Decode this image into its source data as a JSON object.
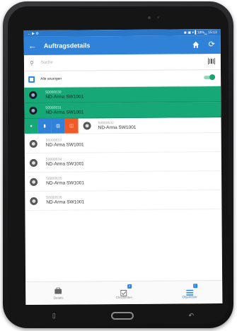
{
  "colors": {
    "primary": "#2f82d8",
    "selected": "#17a877",
    "delete": "#f05a28",
    "badge": "#2f82d8"
  },
  "statusbar": {
    "left": "← ▶ ⚙",
    "right": "◉ ▣ ▾ ▌18%▁ 15:13"
  },
  "appbar": {
    "title": "Auftragsdetails",
    "icons": [
      "back-arrow-icon",
      "home-icon",
      "refresh-icon"
    ]
  },
  "search": {
    "placeholder": "Suche",
    "value": ""
  },
  "show_all": {
    "label": "Alle anzeigen",
    "toggle_on": true
  },
  "rows": [
    {
      "id": "50000630",
      "name": "ND-Arma SW1001",
      "selected": true
    },
    {
      "id": "50000631",
      "name": "ND-Arma SW1001",
      "selected": true
    },
    {
      "id": "50000632",
      "name": "ND-Arma SW1001",
      "selected": false,
      "swiped": true
    },
    {
      "id": "50000633",
      "name": "ND-Arma SW1001",
      "selected": false
    },
    {
      "id": "50000634",
      "name": "ND-Arma SW1001",
      "selected": false
    },
    {
      "id": "50000635",
      "name": "ND-Arma SW1001",
      "selected": false
    },
    {
      "id": "50000636",
      "name": "ND-Arma SW1001",
      "selected": false
    }
  ],
  "swipe_actions": [
    "dot-icon",
    "document-icon",
    "list-icon",
    "delete-icon"
  ],
  "bottom_nav": [
    {
      "label": "Details",
      "icon": "briefcase-icon",
      "active": false,
      "badge": ""
    },
    {
      "label": "Checklisten",
      "icon": "checklist-icon",
      "active": false,
      "badge": "2"
    },
    {
      "label": "Objektliste",
      "icon": "list-icon",
      "active": true,
      "badge": "1"
    }
  ]
}
